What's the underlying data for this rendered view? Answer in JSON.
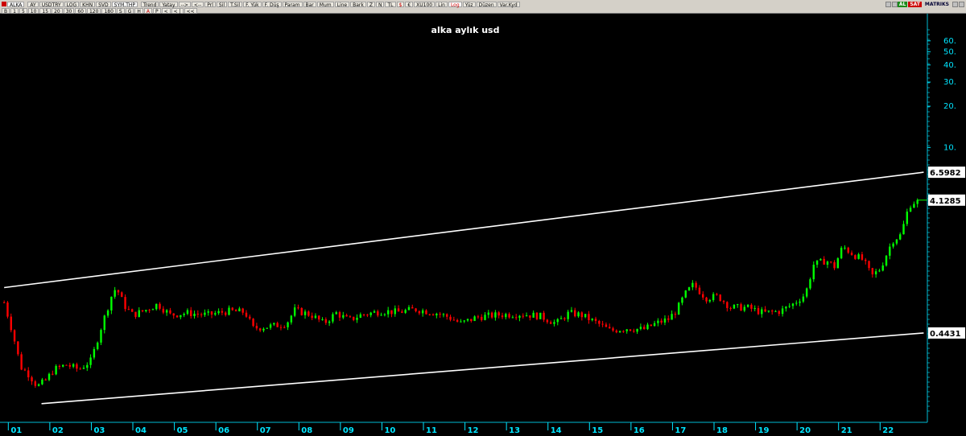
{
  "toolbar": {
    "row1": [
      {
        "label": "ALKA",
        "kind": "symbol"
      },
      {
        "label": "AY"
      },
      {
        "label": "USDTRY"
      },
      {
        "label": "LOG"
      },
      {
        "label": "KHN"
      },
      {
        "label": "SVD"
      },
      {
        "label": "SYM.THP",
        "kind": "dropdown"
      }
    ],
    "row1b": [
      {
        "label": "Trend"
      },
      {
        "label": "Yatay"
      },
      {
        "label": "-->"
      },
      {
        "label": "<--"
      },
      {
        "label": "Prl"
      },
      {
        "label": "Sil"
      },
      {
        "label": "T.Sil"
      },
      {
        "label": "F. Yük"
      },
      {
        "label": "F. Düş"
      },
      {
        "label": "Param"
      },
      {
        "label": "Bar"
      },
      {
        "label": "Mum"
      },
      {
        "label": "Line"
      },
      {
        "label": "Bark"
      },
      {
        "label": "Z"
      },
      {
        "label": "N"
      },
      {
        "label": "TL"
      },
      {
        "label": "$"
      },
      {
        "label": "€"
      },
      {
        "label": "XU100"
      },
      {
        "label": "Lin"
      },
      {
        "label": "Log"
      },
      {
        "label": "Yüz"
      },
      {
        "label": "Düzen"
      },
      {
        "label": "Var.Kyd"
      }
    ],
    "row2": [
      "B",
      "1",
      "5",
      "10",
      "15",
      "20",
      "30",
      "60",
      "120",
      "180",
      "S",
      "G",
      "H",
      "A",
      "P",
      "<",
      "< |",
      "<<"
    ],
    "right": {
      "al": "AL",
      "sat": "SAT",
      "brand": "MATRIKS"
    }
  },
  "chart_data": {
    "type": "candlestick",
    "title": "alka aylık usd",
    "y_scale": "log",
    "y_tick_labels": [
      "60.",
      "50.",
      "40.",
      "30.",
      "20.",
      "10."
    ],
    "y_ticks": [
      60,
      50,
      40,
      30,
      20,
      10
    ],
    "x_tick_labels": [
      "01",
      "02",
      "03",
      "04",
      "05",
      "06",
      "07",
      "08",
      "09",
      "10",
      "11",
      "12",
      "13",
      "14",
      "15",
      "16",
      "17",
      "18",
      "19",
      "20",
      "21",
      "22"
    ],
    "price_labels": [
      {
        "label": "6.5982",
        "value": 6.5982
      },
      {
        "label": "4.1285",
        "value": 4.1285
      },
      {
        "label": "0.4431",
        "value": 0.4431
      }
    ],
    "last_price": 4.1285,
    "channel": {
      "upper": {
        "start": {
          "t": 2000.9,
          "v": 0.95
        },
        "end": {
          "t": 2023.05,
          "v": 6.5982
        }
      },
      "lower": {
        "start": {
          "t": 2001.8,
          "v": 0.135
        },
        "end": {
          "t": 2023.05,
          "v": 0.4431
        }
      }
    },
    "key_points": [
      {
        "t": 2000.9,
        "v": 0.74
      },
      {
        "t": 2001.1,
        "v": 0.45
      },
      {
        "t": 2001.3,
        "v": 0.25
      },
      {
        "t": 2001.5,
        "v": 0.22
      },
      {
        "t": 2001.7,
        "v": 0.18
      },
      {
        "t": 2001.9,
        "v": 0.2
      },
      {
        "t": 2002.1,
        "v": 0.24
      },
      {
        "t": 2002.4,
        "v": 0.26
      },
      {
        "t": 2002.7,
        "v": 0.24
      },
      {
        "t": 2003.0,
        "v": 0.28
      },
      {
        "t": 2003.2,
        "v": 0.45
      },
      {
        "t": 2003.5,
        "v": 0.85
      },
      {
        "t": 2003.6,
        "v": 0.95
      },
      {
        "t": 2003.8,
        "v": 0.7
      },
      {
        "t": 2004.0,
        "v": 0.6
      },
      {
        "t": 2004.3,
        "v": 0.65
      },
      {
        "t": 2004.6,
        "v": 0.72
      },
      {
        "t": 2004.9,
        "v": 0.6
      },
      {
        "t": 2005.3,
        "v": 0.62
      },
      {
        "t": 2005.8,
        "v": 0.6
      },
      {
        "t": 2006.3,
        "v": 0.64
      },
      {
        "t": 2006.7,
        "v": 0.63
      },
      {
        "t": 2006.9,
        "v": 0.48
      },
      {
        "t": 2007.4,
        "v": 0.5
      },
      {
        "t": 2007.7,
        "v": 0.52
      },
      {
        "t": 2007.9,
        "v": 0.65
      },
      {
        "t": 2008.3,
        "v": 0.6
      },
      {
        "t": 2008.6,
        "v": 0.52
      },
      {
        "t": 2008.9,
        "v": 0.62
      },
      {
        "t": 2009.2,
        "v": 0.55
      },
      {
        "t": 2009.5,
        "v": 0.6
      },
      {
        "t": 2010.0,
        "v": 0.64
      },
      {
        "t": 2010.4,
        "v": 0.63
      },
      {
        "t": 2010.8,
        "v": 0.66
      },
      {
        "t": 2011.3,
        "v": 0.62
      },
      {
        "t": 2011.6,
        "v": 0.58
      },
      {
        "t": 2011.9,
        "v": 0.52
      },
      {
        "t": 2012.3,
        "v": 0.58
      },
      {
        "t": 2012.8,
        "v": 0.6
      },
      {
        "t": 2013.3,
        "v": 0.61
      },
      {
        "t": 2013.8,
        "v": 0.59
      },
      {
        "t": 2014.2,
        "v": 0.52
      },
      {
        "t": 2014.5,
        "v": 0.62
      },
      {
        "t": 2014.8,
        "v": 0.6
      },
      {
        "t": 2015.2,
        "v": 0.52
      },
      {
        "t": 2015.5,
        "v": 0.46
      },
      {
        "t": 2015.9,
        "v": 0.48
      },
      {
        "t": 2016.3,
        "v": 0.47
      },
      {
        "t": 2016.6,
        "v": 0.52
      },
      {
        "t": 2016.9,
        "v": 0.56
      },
      {
        "t": 2017.1,
        "v": 0.65
      },
      {
        "t": 2017.3,
        "v": 0.85
      },
      {
        "t": 2017.5,
        "v": 1.0
      },
      {
        "t": 2017.8,
        "v": 0.8
      },
      {
        "t": 2018.1,
        "v": 0.82
      },
      {
        "t": 2018.4,
        "v": 0.68
      },
      {
        "t": 2018.8,
        "v": 0.68
      },
      {
        "t": 2019.2,
        "v": 0.62
      },
      {
        "t": 2019.6,
        "v": 0.64
      },
      {
        "t": 2019.9,
        "v": 0.72
      },
      {
        "t": 2020.2,
        "v": 0.85
      },
      {
        "t": 2020.4,
        "v": 1.4
      },
      {
        "t": 2020.7,
        "v": 1.5
      },
      {
        "t": 2020.9,
        "v": 1.35
      },
      {
        "t": 2021.1,
        "v": 1.9
      },
      {
        "t": 2021.3,
        "v": 1.7
      },
      {
        "t": 2021.6,
        "v": 1.5
      },
      {
        "t": 2021.8,
        "v": 1.15
      },
      {
        "t": 2022.0,
        "v": 1.3
      },
      {
        "t": 2022.3,
        "v": 2.1
      },
      {
        "t": 2022.5,
        "v": 2.3
      },
      {
        "t": 2022.7,
        "v": 3.8
      },
      {
        "t": 2022.9,
        "v": 4.1285
      }
    ],
    "x_range": [
      2000.8,
      2023.1
    ],
    "y_range": [
      0.11,
      85
    ],
    "colors": {
      "up": "#00ff00",
      "down": "#ff0000",
      "axis": "#00e5ff",
      "channel": "#ffffff",
      "title": "#ffffff",
      "background": "#000000",
      "label_bg": "#ffffff"
    }
  }
}
